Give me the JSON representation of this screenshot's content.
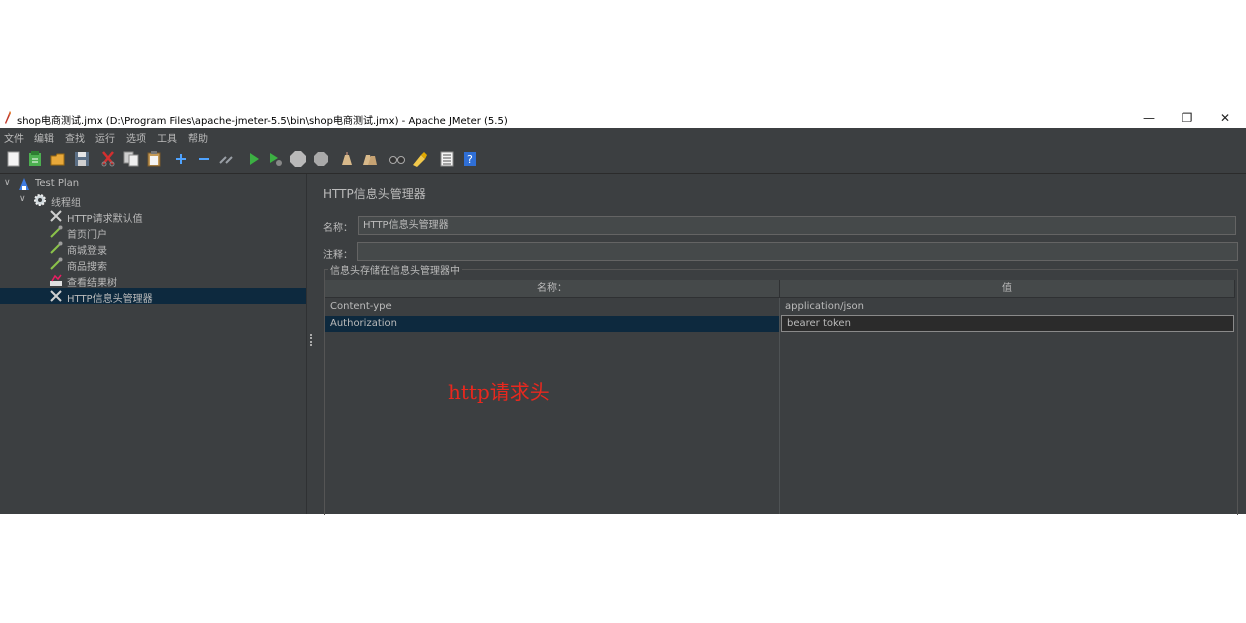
{
  "window": {
    "title": "shop电商测试.jmx (D:\\Program Files\\apache-jmeter-5.5\\bin\\shop电商测试.jmx) - Apache JMeter (5.5)",
    "controls": {
      "minimize": "—",
      "restore": "❐",
      "close": "✕"
    }
  },
  "menubar": {
    "items": [
      "文件",
      "编辑",
      "查找",
      "运行",
      "选项",
      "工具",
      "帮助"
    ]
  },
  "toolbar": {
    "icons": [
      "new-icon",
      "templates-icon",
      "open-icon",
      "save-icon",
      "cut-icon",
      "copy-icon",
      "paste-icon",
      "expand-icon",
      "collapse-icon",
      "toggle-icon",
      "start-icon",
      "start-no-timers-icon",
      "stop-icon",
      "shutdown-icon",
      "clear-icon",
      "clear-all-icon",
      "search-icon",
      "reset-search-icon",
      "function-helper-icon",
      "help-icon"
    ]
  },
  "tree": {
    "items": [
      {
        "label": "Test Plan",
        "level": 0,
        "icon": "test-plan-icon",
        "expanded": true
      },
      {
        "label": "线程组",
        "level": 1,
        "icon": "gear-icon",
        "expanded": true
      },
      {
        "label": "HTTP请求默认值",
        "level": 2,
        "icon": "wrench-icon"
      },
      {
        "label": "首页门户",
        "level": 2,
        "icon": "pipette-icon"
      },
      {
        "label": "商城登录",
        "level": 2,
        "icon": "pipette-icon"
      },
      {
        "label": "商品搜索",
        "level": 2,
        "icon": "pipette-icon"
      },
      {
        "label": "查看结果树",
        "level": 2,
        "icon": "listener-icon"
      },
      {
        "label": "HTTP信息头管理器",
        "level": 2,
        "icon": "wrench-icon",
        "selected": true
      }
    ]
  },
  "panel": {
    "title": "HTTP信息头管理器",
    "name_label": "名称：",
    "name_value": "HTTP信息头管理器",
    "comment_label": "注释：",
    "comment_value": "",
    "group_title": "信息头存储在信息头管理器中",
    "table": {
      "headers": [
        "名称：",
        "值"
      ],
      "rows": [
        {
          "name": "Content-ype",
          "value": "application/json"
        },
        {
          "name": "Authorization",
          "value": "bearer token",
          "selected": true
        }
      ]
    }
  },
  "annotation": "http请求头",
  "colors": {
    "background": "#3c3f41",
    "selection": "#0d293e",
    "text": "#bbbbbb",
    "annotation": "#e8281e"
  }
}
